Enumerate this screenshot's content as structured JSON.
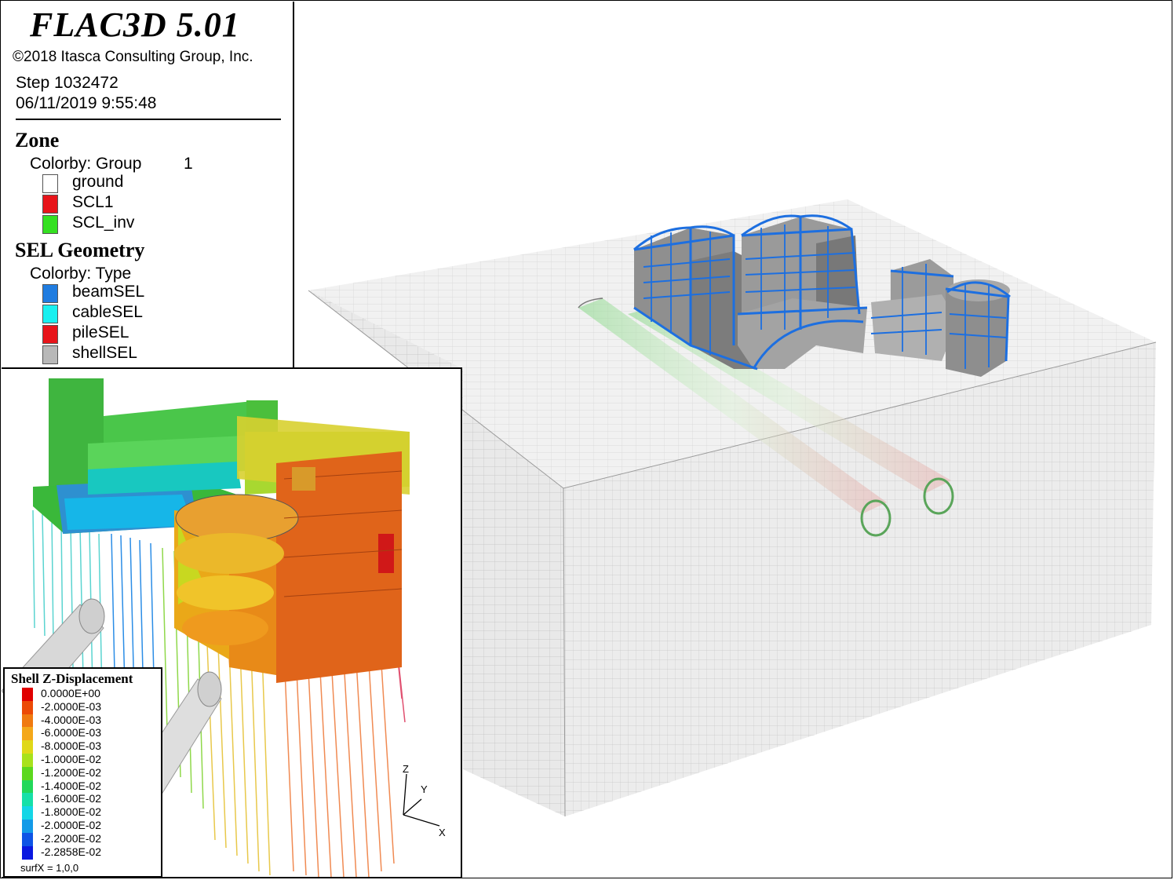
{
  "header": {
    "app_title": "FLAC3D 5.01",
    "copyright": "©2018 Itasca Consulting Group, Inc.",
    "step": "Step 1032472",
    "datetime": "06/11/2019 9:55:48"
  },
  "zone_legend": {
    "title": "Zone",
    "colorby": "Colorby: Group",
    "colorby_value": "1",
    "items": [
      {
        "label": "ground",
        "color": "#ffffff"
      },
      {
        "label": "SCL1",
        "color": "#e8141a"
      },
      {
        "label": "SCL_inv",
        "color": "#34e021"
      }
    ]
  },
  "sel_legend": {
    "title": "SEL Geometry",
    "colorby": "Colorby: Type",
    "items": [
      {
        "label": "beamSEL",
        "color": "#1f7ce0"
      },
      {
        "label": "cableSEL",
        "color": "#18f0f0"
      },
      {
        "label": "pileSEL",
        "color": "#e8141a"
      },
      {
        "label": "shellSEL",
        "color": "#b8b8b8"
      }
    ]
  },
  "displacement_legend": {
    "title": "Shell Z-Displacement",
    "items": [
      {
        "label": "0.0000E+00",
        "color": "#e00000"
      },
      {
        "label": "-2.0000E-03",
        "color": "#ec4a06"
      },
      {
        "label": "-4.0000E-03",
        "color": "#f07a10"
      },
      {
        "label": "-6.0000E-03",
        "color": "#f4a81a"
      },
      {
        "label": "-8.0000E-03",
        "color": "#e0d818"
      },
      {
        "label": "-1.0000E-02",
        "color": "#a8e21c"
      },
      {
        "label": "-1.2000E-02",
        "color": "#5cd81e"
      },
      {
        "label": "-1.4000E-02",
        "color": "#22d85a"
      },
      {
        "label": "-1.6000E-02",
        "color": "#16e0a8"
      },
      {
        "label": "-1.8000E-02",
        "color": "#14d6e6"
      },
      {
        "label": "-2.0000E-02",
        "color": "#129ae8"
      },
      {
        "label": "-2.2000E-02",
        "color": "#0e54e6"
      },
      {
        "label": "-2.2858E-02",
        "color": "#0a18e0"
      }
    ],
    "footer": "surfX = 1,0,0"
  },
  "axes": {
    "x": "X",
    "y": "Y",
    "z": "Z"
  }
}
